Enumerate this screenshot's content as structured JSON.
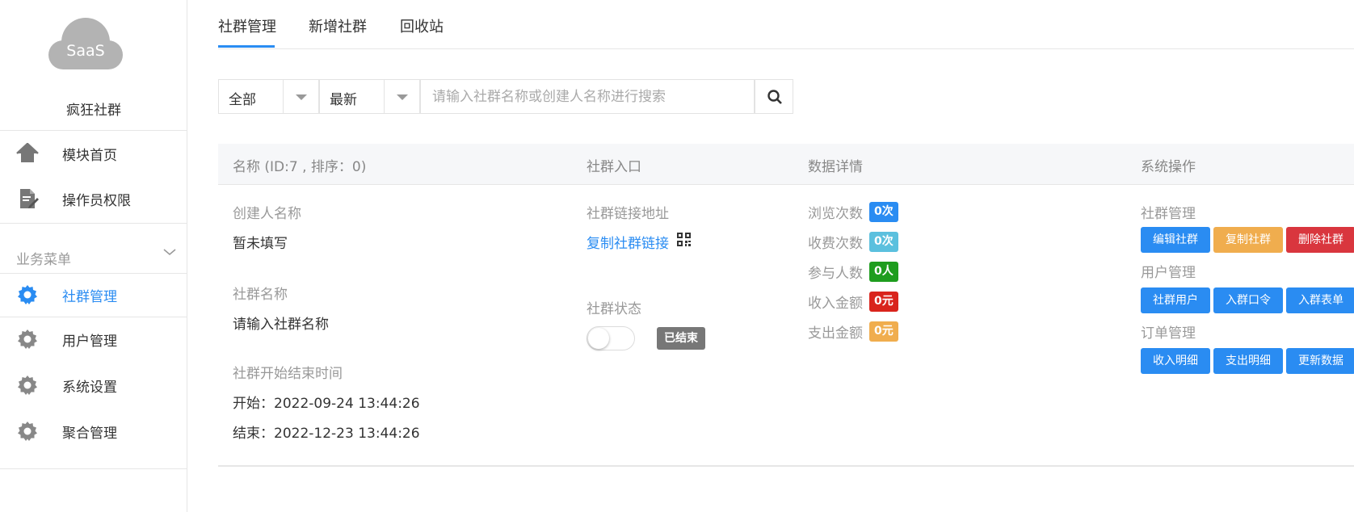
{
  "brand": {
    "logo_text": "SaaS",
    "site_name": "疯狂社群"
  },
  "sidebar": {
    "items": [
      {
        "label": "模块首页",
        "icon": "home-icon"
      },
      {
        "label": "操作员权限",
        "icon": "document-edit-icon"
      }
    ],
    "section_label": "业务菜单",
    "menu": [
      {
        "label": "社群管理",
        "icon": "gear-icon",
        "active": true
      },
      {
        "label": "用户管理",
        "icon": "gear-icon"
      },
      {
        "label": "系统设置",
        "icon": "gear-icon"
      },
      {
        "label": "聚合管理",
        "icon": "gear-icon"
      }
    ]
  },
  "tabs": [
    {
      "label": "社群管理",
      "active": true
    },
    {
      "label": "新增社群"
    },
    {
      "label": "回收站"
    }
  ],
  "filters": {
    "scope": "全部",
    "sort": "最新",
    "search_placeholder": "请输入社群名称或创建人名称进行搜索"
  },
  "table": {
    "headers": [
      "名称 (ID:7 , 排序：0)",
      "社群入口",
      "数据详情",
      "系统操作"
    ],
    "row": {
      "creator_label": "创建人名称",
      "creator_value": "暂未填写",
      "name_label": "社群名称",
      "name_value": "请输入社群名称",
      "time_label": "社群开始结束时间",
      "start": "开始：2022-09-24 13:44:26",
      "end": "结束：2022-12-23 13:44:26",
      "link_label": "社群链接地址",
      "link_text": "复制社群链接",
      "status_label": "社群状态",
      "status_badge": "已结束",
      "toggle_on": false,
      "stats": [
        {
          "label": "浏览次数",
          "value": "0次",
          "color": "#2a8cf2"
        },
        {
          "label": "收费次数",
          "value": "0次",
          "color": "#5bc0de"
        },
        {
          "label": "参与人数",
          "value": "0人",
          "color": "#1e9d1e"
        },
        {
          "label": "收入金额",
          "value": "0元",
          "color": "#d9241c"
        },
        {
          "label": "支出金额",
          "value": "0元",
          "color": "#f0ad4e"
        }
      ],
      "ops": [
        {
          "group": "社群管理",
          "buttons": [
            {
              "label": "编辑社群",
              "color": "#2a8cf2"
            },
            {
              "label": "复制社群",
              "color": "#f0ad4e"
            },
            {
              "label": "删除社群",
              "color": "#d9363e"
            }
          ]
        },
        {
          "group": "用户管理",
          "buttons": [
            {
              "label": "社群用户",
              "color": "#2a8cf2"
            },
            {
              "label": "入群口令",
              "color": "#2a8cf2"
            },
            {
              "label": "入群表单",
              "color": "#2a8cf2"
            }
          ]
        },
        {
          "group": "订单管理",
          "buttons": [
            {
              "label": "收入明细",
              "color": "#2a8cf2"
            },
            {
              "label": "支出明细",
              "color": "#2a8cf2"
            },
            {
              "label": "更新数据",
              "color": "#2a8cf2"
            }
          ]
        }
      ]
    }
  }
}
